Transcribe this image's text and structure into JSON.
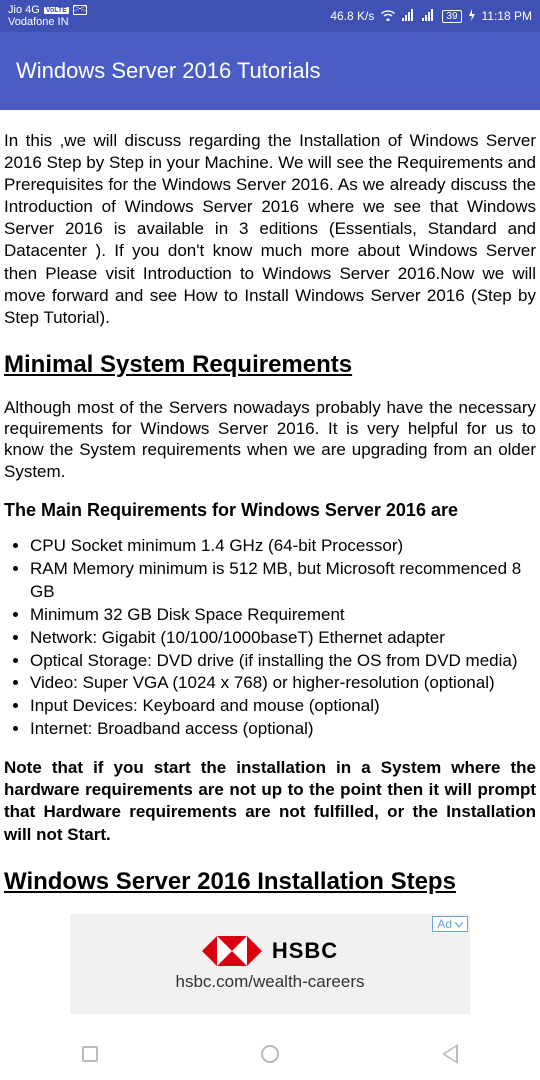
{
  "status": {
    "carrier1_top": "Jio 4G",
    "carrier1_bottom": "Vodafone IN",
    "volte": "VoLTE",
    "speed": "46.8 K/s",
    "battery": "39",
    "time": "11:18 PM"
  },
  "app_bar": {
    "title": "Windows Server 2016 Tutorials"
  },
  "article": {
    "intro": "In this ,we will discuss regarding the Installation of Windows Server 2016 Step by Step in your Machine. We will see the Requirements and Prerequisites for the Windows Server 2016. As we already discuss the Introduction of Windows Server 2016 where we see that Windows Server 2016 is available in 3 editions (Essentials, Standard and Datacenter ). If you don't know much more about Windows Server then Please visit Introduction to Windows Server 2016.Now we will move forward and see How to Install Windows Server 2016 (Step by Step Tutorial).",
    "h1": "Minimal System Requirements",
    "desc": "Although most of the Servers nowadays probably have the necessary requirements for Windows Server 2016. It is very helpful for us to know the System requirements when we are upgrading from an older System.",
    "sub_h": "The Main Requirements for Windows Server 2016 are",
    "reqs": [
      "CPU Socket minimum 1.4 GHz (64-bit Processor)",
      "RAM Memory minimum is 512 MB, but Microsoft recommenced 8 GB",
      "Minimum 32 GB Disk Space Requirement",
      "Network: Gigabit (10/100/1000baseT) Ethernet adapter",
      "Optical Storage: DVD drive (if installing the OS from DVD media)",
      "Video: Super VGA (1024 x 768) or higher-resolution (optional)",
      "Input Devices: Keyboard and mouse (optional)",
      "Internet: Broadband access (optional)"
    ],
    "note": "Note that if you start the installation in a System where the hardware requirements are not up to the point then it will prompt that Hardware requirements are not fulfilled, or the Installation will not Start.",
    "h2": "Windows Server 2016 Installation Steps "
  },
  "ad": {
    "label": "Ad",
    "brand": "HSBC",
    "sub": "hsbc.com/wealth-careers"
  }
}
